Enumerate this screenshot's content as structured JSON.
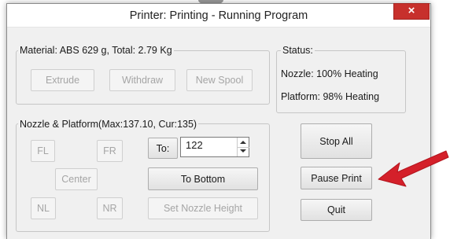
{
  "window": {
    "title": "Printer: Printing - Running Program",
    "close_symbol": "×"
  },
  "material": {
    "legend": "Material: ABS 629 g,  Total: 2.79 Kg",
    "extrude_label": "Extrude",
    "withdraw_label": "Withdraw",
    "new_spool_label": "New Spool"
  },
  "status": {
    "legend": "Status:",
    "nozzle": "Nozzle: 100%  Heating",
    "platform": "Platform: 98%  Heating"
  },
  "nozzle_platform": {
    "legend": "Nozzle & Platform(Max:137.10, Cur:135)",
    "fl_label": "FL",
    "fr_label": "FR",
    "to_label": "To:",
    "height_value": "122",
    "center_label": "Center",
    "to_bottom_label": "To Bottom",
    "nl_label": "NL",
    "nr_label": "NR",
    "set_nozzle_height_label": "Set Nozzle Height"
  },
  "actions": {
    "stop_all_label": "Stop All",
    "pause_print_label": "Pause Print",
    "quit_label": "Quit"
  },
  "colors": {
    "annotation_arrow": "#d4202a",
    "close_button": "#c7302c"
  },
  "icons": {
    "close": "close-icon",
    "spinner_up": "spinner-up-icon",
    "spinner_down": "spinner-down-icon",
    "annotation": "red-arrow-annotation"
  }
}
